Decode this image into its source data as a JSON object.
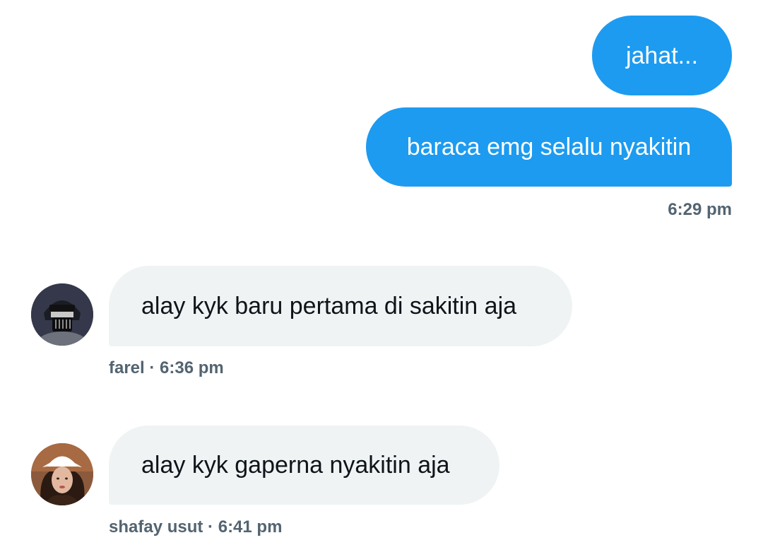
{
  "messages": [
    {
      "direction": "outgoing",
      "text": "jahat..."
    },
    {
      "direction": "outgoing",
      "text": "baraca emg selalu nyakitin",
      "time": "6:29 pm"
    },
    {
      "direction": "incoming",
      "text": "alay kyk baru pertama di sakitin aja",
      "sender": "farel",
      "separator": "·",
      "time": "6:36 pm",
      "avatar_icon": "helmet-mask-avatar"
    },
    {
      "direction": "incoming",
      "text": "alay kyk gaperna nyakitin aja",
      "sender": "shafay usut",
      "separator": "·",
      "time": "6:41 pm",
      "avatar_icon": "woman-hat-avatar"
    }
  ],
  "colors": {
    "outgoing_bubble": "#1d9bf0",
    "incoming_bubble": "#eff3f4",
    "meta_text": "#536471",
    "message_text": "#0f1419"
  }
}
